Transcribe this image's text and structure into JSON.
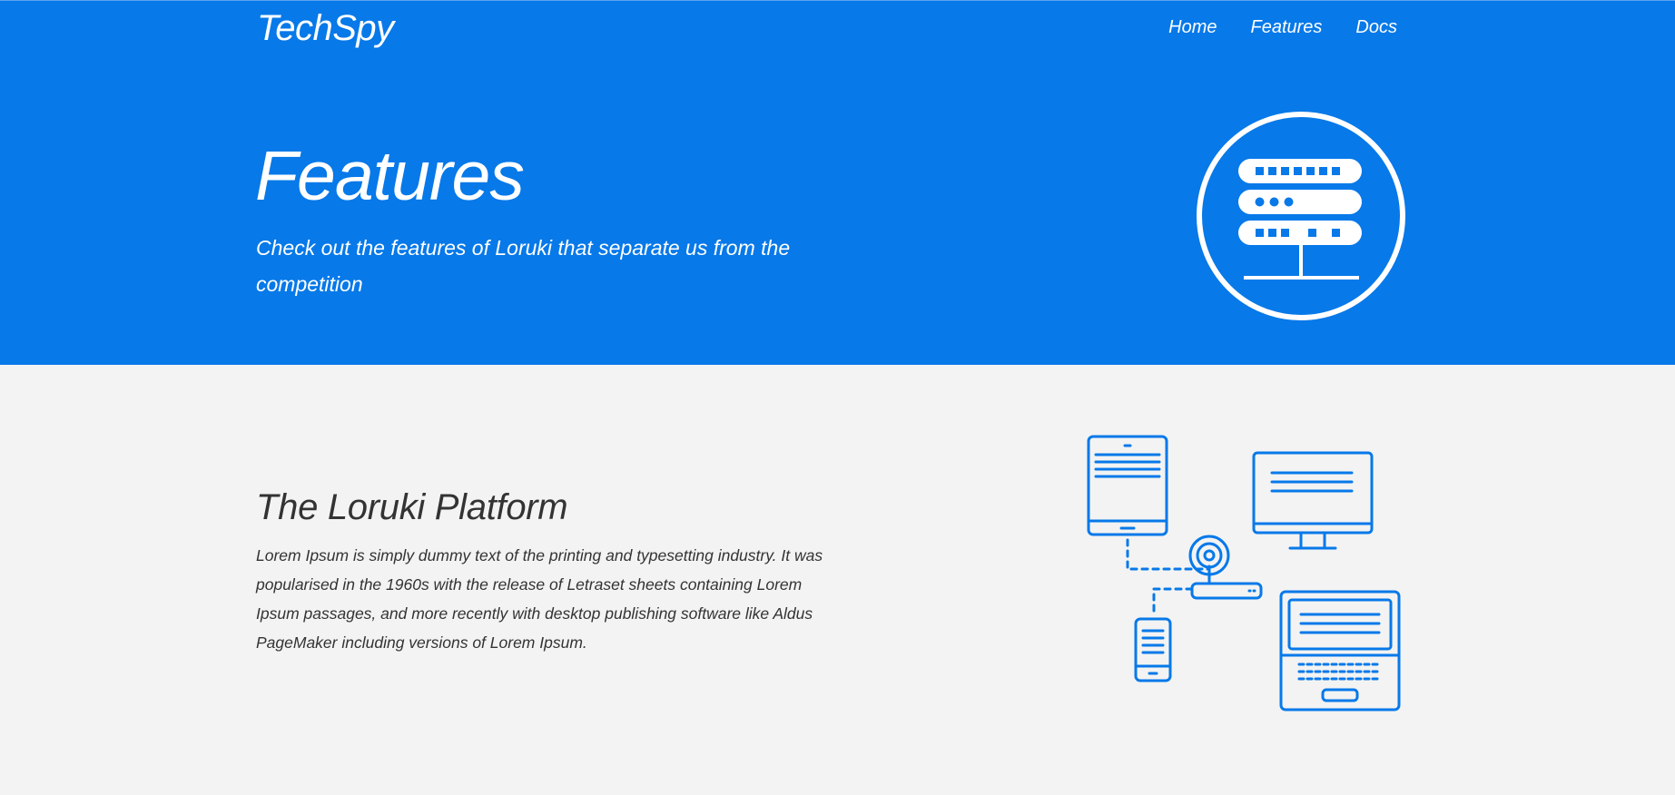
{
  "header": {
    "brand": "TechSpy",
    "nav": [
      {
        "label": "Home"
      },
      {
        "label": "Features"
      },
      {
        "label": "Docs"
      }
    ]
  },
  "hero": {
    "title": "Features",
    "subtitle": "Check out the features of Loruki that separate us from the competition",
    "icon": "server-icon"
  },
  "platform": {
    "title": "The Loruki Platform",
    "body": "Lorem Ipsum is simply dummy text of the printing and typesetting industry. It was popularised in the 1960s with the release of Letraset sheets containing Lorem Ipsum passages, and more recently with desktop publishing software like Aldus PageMaker including versions of Lorem Ipsum.",
    "illustration": "connected-devices-illustration"
  },
  "colors": {
    "primary": "#0779e9",
    "background": "#f3f3f3",
    "text": "#333333"
  }
}
